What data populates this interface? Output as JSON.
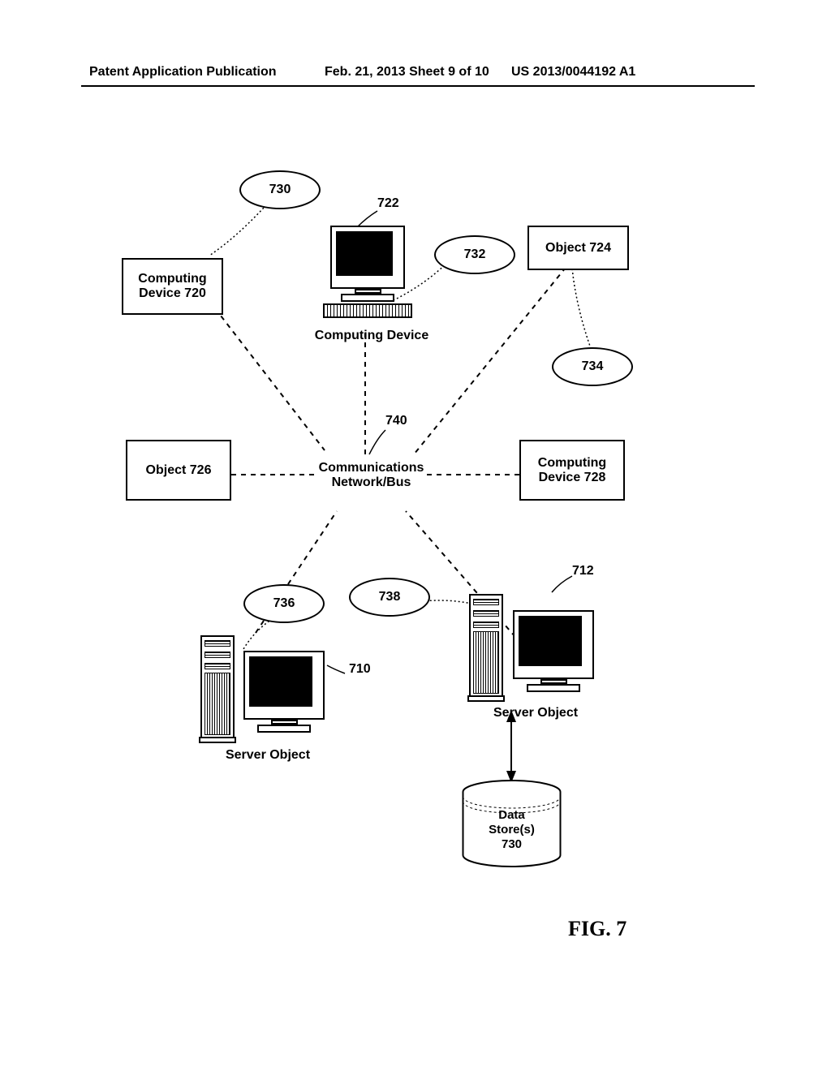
{
  "header": {
    "left": "Patent Application Publication",
    "center": "Feb. 21, 2013  Sheet 9 of 10",
    "right": "US 2013/0044192 A1"
  },
  "refs": {
    "r710": "710",
    "r712": "712",
    "r720": "Computing Device 720",
    "r722": "722",
    "r724": "Object 724",
    "r726": "Object 726",
    "r728": "Computing Device 728",
    "r730": "730",
    "r732": "732",
    "r734": "734",
    "r736": "736",
    "r738": "738",
    "r740": "740"
  },
  "labels": {
    "computingDevice": "Computing Device",
    "commNetwork1": "Communications",
    "commNetwork2": "Network/Bus",
    "serverObjectL": "Server Object",
    "serverObjectR": "Server Object",
    "dataStore1": "Data",
    "dataStore2": "Store(s)",
    "dataStore3": "730"
  },
  "figure": "FIG. 7"
}
